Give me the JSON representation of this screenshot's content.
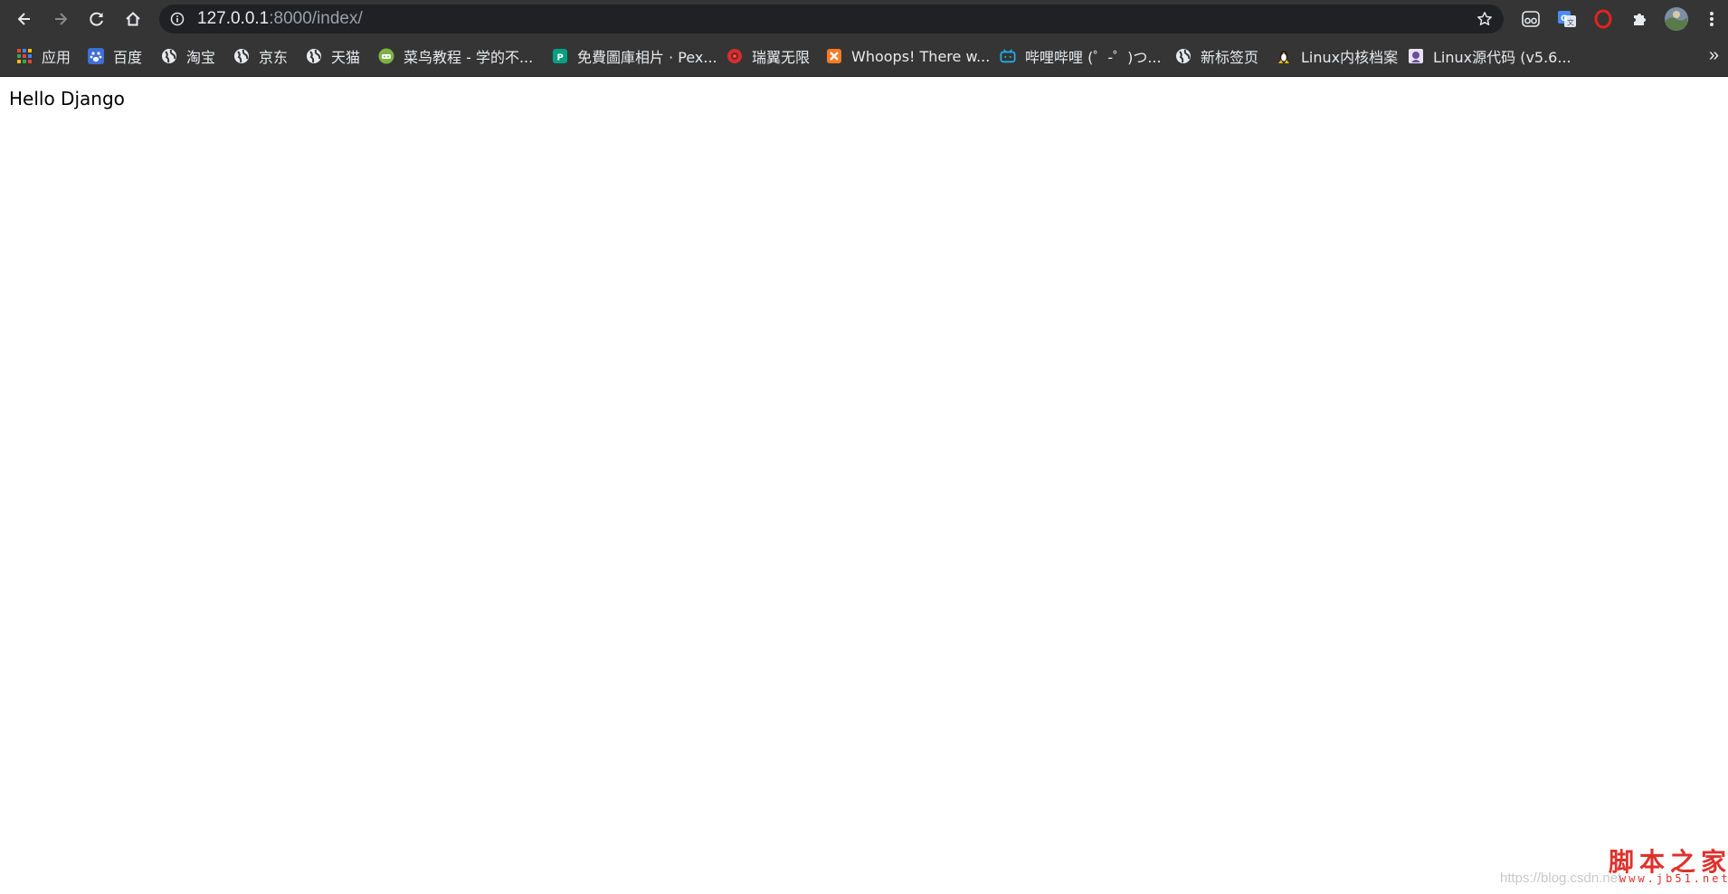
{
  "browser": {
    "address_bar": {
      "url_host": "127.0.0.1",
      "url_rest": ":8000/index/"
    },
    "bookmarks": [
      {
        "label": "应用",
        "icon": "apps-grid-icon"
      },
      {
        "label": "百度",
        "icon": "baidu-paw-icon"
      },
      {
        "label": "淘宝",
        "icon": "globe-icon"
      },
      {
        "label": "京东",
        "icon": "globe-icon"
      },
      {
        "label": "天猫",
        "icon": "globe-icon"
      },
      {
        "label": "菜鸟教程 - 学的不...",
        "icon": "runoob-icon"
      },
      {
        "label": "免費圖庫相片 · Pex...",
        "icon": "pexels-icon"
      },
      {
        "label": "瑞翼无限",
        "icon": "ruiyi-icon"
      },
      {
        "label": "Whoops! There w...",
        "icon": "xampp-icon"
      },
      {
        "label": "哔哩哔哩 (゜-゜)つ...",
        "icon": "bilibili-icon"
      },
      {
        "label": "新标签页",
        "icon": "globe-icon"
      },
      {
        "label": "Linux内核档案",
        "icon": "tux-icon"
      },
      {
        "label": "Linux源代码 (v5.6...",
        "icon": "bootlin-icon"
      }
    ],
    "more_symbol": "»"
  },
  "page": {
    "text": "Hello Django"
  },
  "watermark": {
    "logo": "脚本之家",
    "site": "www.jb51.net",
    "blog_url": "https://blog.csdn.net"
  },
  "colors": {
    "toolbar_bg": "#353535",
    "omnibox_bg": "#202124",
    "text_light": "#e8eaed",
    "text_muted": "#9aa0a6",
    "watermark_red": "#e0312c"
  }
}
